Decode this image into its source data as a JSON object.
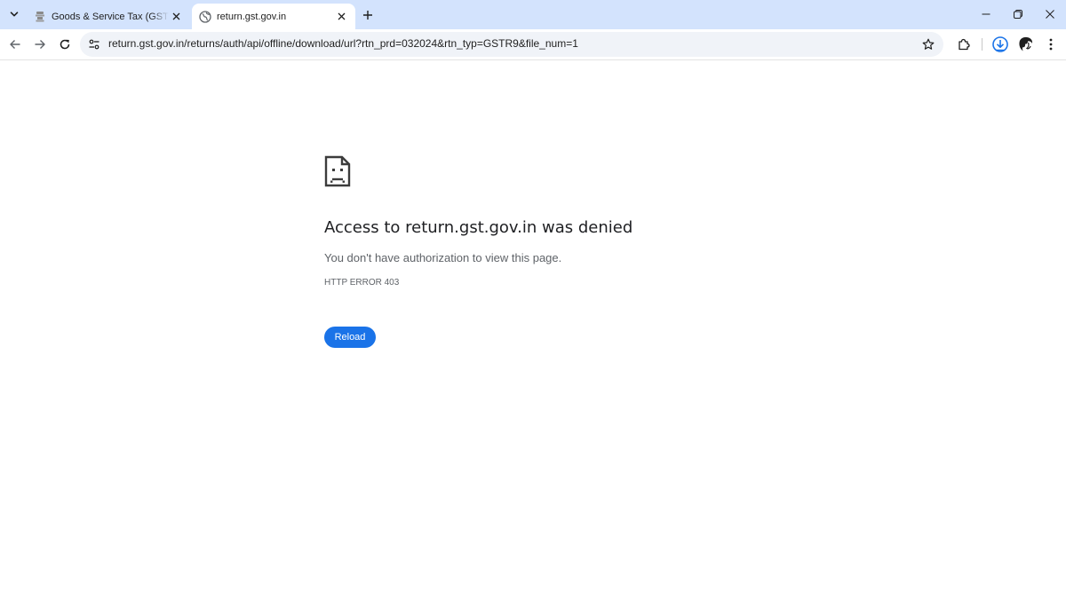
{
  "browser": {
    "tabs": [
      {
        "title": "Goods & Service Tax (GST) | User Dashboard",
        "active": false,
        "favicon": "emblem-icon"
      },
      {
        "title": "return.gst.gov.in",
        "active": true,
        "favicon": "globe-icon"
      }
    ],
    "address_bar": {
      "url": "return.gst.gov.in/returns/auth/api/offline/download/url?rtn_prd=032024&rtn_typ=GSTR9&file_num=1"
    },
    "icons": {
      "tab_search": "chevron-down-icon",
      "new_tab": "plus-icon",
      "back": "arrow-left-icon",
      "forward": "arrow-right-icon",
      "reload": "reload-icon",
      "site_info": "tune-icon",
      "bookmark": "star-icon",
      "extensions": "puzzle-icon",
      "downloads": "download-icon",
      "profile": "avatar",
      "menu": "kebab-menu-icon",
      "minimize": "minimize-icon",
      "restore": "restore-icon",
      "close": "close-icon"
    }
  },
  "error_page": {
    "heading": "Access to return.gst.gov.in was denied",
    "message": "You don't have authorization to view this page.",
    "error_code": "HTTP ERROR 403",
    "reload_label": "Reload",
    "icon": "sad-page-icon"
  },
  "colors": {
    "tabstrip": "#d3e3fd",
    "accent": "#1a73e8",
    "heading": "#202124",
    "secondary_text": "#5f6368"
  }
}
